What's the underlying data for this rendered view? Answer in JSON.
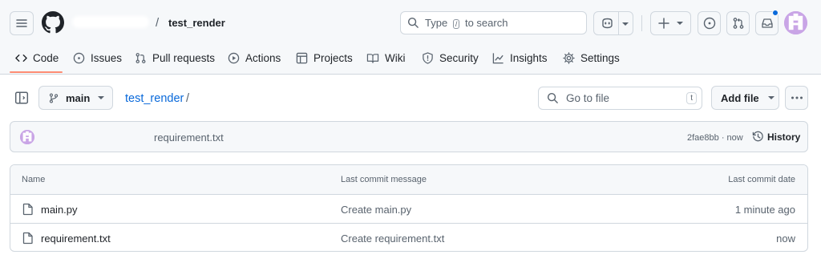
{
  "header": {
    "repo_name": "test_render",
    "path_separator": "/",
    "search": {
      "prefix": "Type",
      "shortcut": "/",
      "suffix": "to search"
    },
    "icons": [
      "menu-icon",
      "github-logo-icon",
      "search-icon",
      "copilot-icon",
      "chevron-down-icon",
      "plus-icon",
      "issue-opened-icon",
      "pull-request-icon",
      "inbox-icon",
      "avatar"
    ]
  },
  "tabs": [
    {
      "label": "Code",
      "icon": "code-icon",
      "selected": true
    },
    {
      "label": "Issues",
      "icon": "issue-icon"
    },
    {
      "label": "Pull requests",
      "icon": "pull-request-icon"
    },
    {
      "label": "Actions",
      "icon": "play-icon"
    },
    {
      "label": "Projects",
      "icon": "table-icon"
    },
    {
      "label": "Wiki",
      "icon": "book-icon"
    },
    {
      "label": "Security",
      "icon": "shield-icon"
    },
    {
      "label": "Insights",
      "icon": "graph-icon"
    },
    {
      "label": "Settings",
      "icon": "gear-icon"
    }
  ],
  "toolbar": {
    "branch": "main",
    "breadcrumb_repo": "test_render",
    "breadcrumb_sep": "/",
    "goto_placeholder": "Go to file",
    "goto_shortcut": "t",
    "add_file": "Add file"
  },
  "commit": {
    "message": "requirement.txt",
    "hash_time": "2fae8bb · now",
    "history": "History"
  },
  "files": {
    "headers": {
      "name": "Name",
      "message": "Last commit message",
      "date": "Last commit date"
    },
    "rows": [
      {
        "name": "main.py",
        "message": "Create main.py",
        "date": "1 minute ago"
      },
      {
        "name": "requirement.txt",
        "message": "Create requirement.txt",
        "date": "now"
      }
    ]
  },
  "colors": {
    "accent_link": "#0969da",
    "tab_underline": "#fd8c73",
    "border": "#d0d7de",
    "muted_bg": "#f6f8fa",
    "avatar": "#c9a5e6"
  }
}
